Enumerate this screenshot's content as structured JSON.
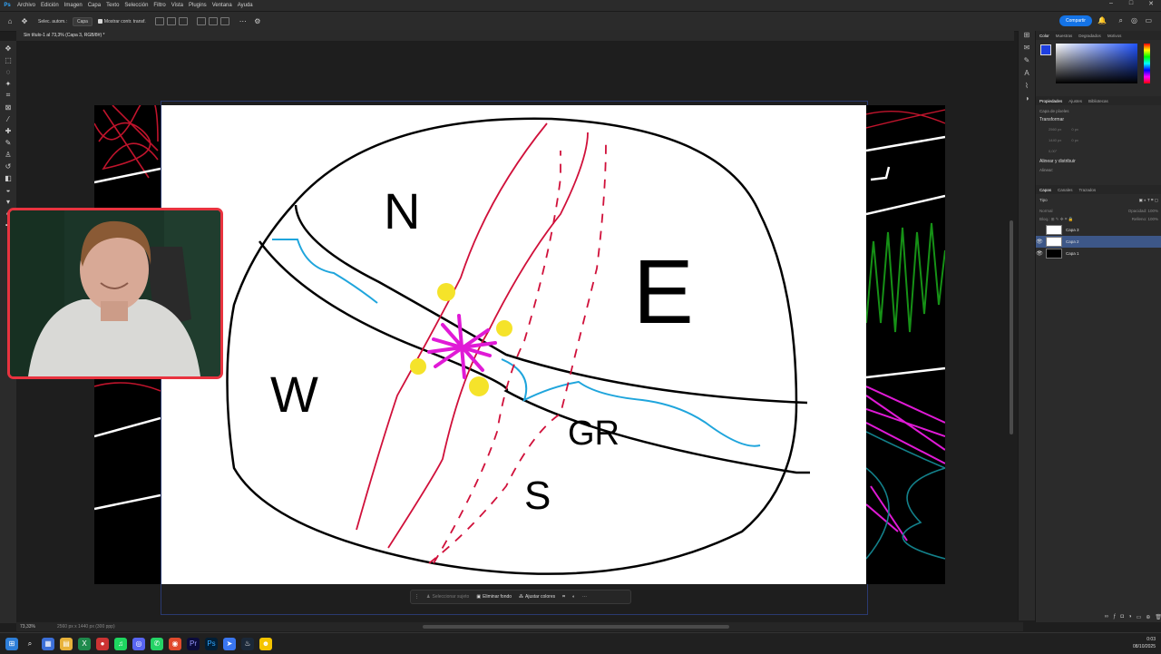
{
  "menubar": {
    "logo": "Ps",
    "items": [
      "Archivo",
      "Edición",
      "Imagen",
      "Capa",
      "Texto",
      "Selección",
      "Filtro",
      "Vista",
      "Plugins",
      "Ventana",
      "Ayuda"
    ]
  },
  "options": {
    "auto_select_label": "Selec. autom.:",
    "auto_select_value": "Capa",
    "transform_label": "Mostrar contr. transf.",
    "share": "Compartir"
  },
  "document": {
    "tab": "Sin título-1 al 73,3% (Capa 3, RGB/8#) *",
    "zoom": "73,33%",
    "size": "2560 px x 1440 px (300 ppp)"
  },
  "drawing": {
    "labels": {
      "north": "N",
      "east": "E",
      "west": "W",
      "south": "S",
      "gr": "GR"
    }
  },
  "context_bar": {
    "select_subject": "Seleccionar sujeto",
    "remove_bg": "Eliminar fondo",
    "adjust_colors": "Ajustar colores"
  },
  "panels": {
    "color_tabs": [
      "Color",
      "Muestras",
      "Degradados",
      "Motivos"
    ],
    "props_tabs": [
      "Propiedades",
      "Ajustes",
      "Bibliotecas"
    ],
    "pixel_layer": "Capa de píxeles",
    "transform": "Transformar",
    "transform_fields": {
      "w": "2560 px",
      "h": "1440 px",
      "x": "0 px",
      "y": "0 px",
      "angle": "0,00°"
    },
    "align": "Alinear y distribuir",
    "align_sub": "Alinear:",
    "layers_tabs": [
      "Capas",
      "Canales",
      "Trazados"
    ],
    "filter": "Tipo",
    "blend": "Normal",
    "opacity_label": "Opacidad:",
    "opacity": "100%",
    "fill_label": "Relleno:",
    "fill": "100%",
    "lock_label": "Bloq.:",
    "layers": [
      {
        "name": "Capa 3",
        "visible": false,
        "selected": false
      },
      {
        "name": "Capa 2",
        "visible": true,
        "selected": true
      },
      {
        "name": "Capa 1",
        "visible": true,
        "selected": false
      }
    ]
  },
  "clock": {
    "time": "0:03",
    "date": "08/10/2025"
  },
  "colors": {
    "accent": "#1473e6",
    "webcam_border": "#e8333f",
    "selected_layer": "#3d5788"
  }
}
